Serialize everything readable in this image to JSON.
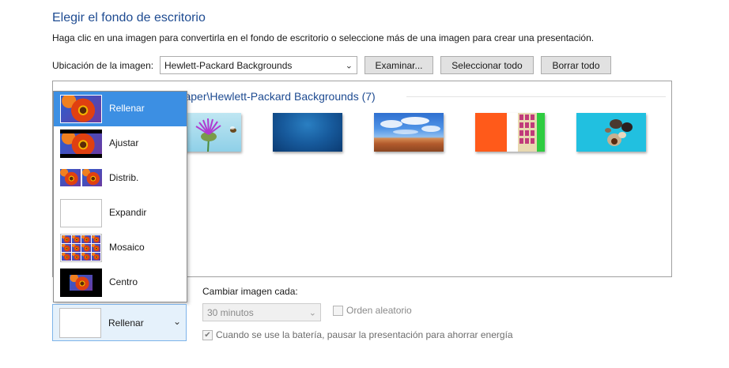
{
  "page": {
    "title": "Elegir el fondo de escritorio",
    "subtitle": "Haga clic en una imagen para convertirla en el fondo de escritorio o seleccione más de una imagen para crear una presentación."
  },
  "location": {
    "label": "Ubicación de la imagen:",
    "selected": "Hewlett-Packard Backgrounds",
    "browse_label": "Examinar...",
    "select_all_label": "Seleccionar todo",
    "clear_all_label": "Borrar todo"
  },
  "gallery": {
    "group_header": "C:\\Windows\\Web\\Wallpaper\\Hewlett-Packard Backgrounds (7)",
    "thumbnails": [
      {
        "name": "thistle-bee-thumbnail"
      },
      {
        "name": "blue-gradient-thumbnail"
      },
      {
        "name": "desert-sky-thumbnail"
      },
      {
        "name": "matches-thumbnail"
      },
      {
        "name": "stones-thumbnail"
      }
    ]
  },
  "position_menu": {
    "items": [
      {
        "label": "Rellenar",
        "active": true
      },
      {
        "label": "Ajustar",
        "active": false
      },
      {
        "label": "Distrib.",
        "active": false
      },
      {
        "label": "Expandir",
        "active": false
      },
      {
        "label": "Mosaico",
        "active": false
      },
      {
        "label": "Centro",
        "active": false
      }
    ],
    "selected": "Rellenar"
  },
  "slideshow": {
    "interval_label": "Cambiar imagen cada:",
    "interval_value": "30 minutos",
    "shuffle_label": "Orden aleatorio",
    "shuffle_checked": false,
    "battery_label": "Cuando se use la batería, pausar la presentación para ahorrar energía",
    "battery_checked": true
  },
  "colors": {
    "title": "#1e4b91",
    "menu_highlight": "#3c8fe3",
    "combo_background": "#e5f1fb"
  }
}
